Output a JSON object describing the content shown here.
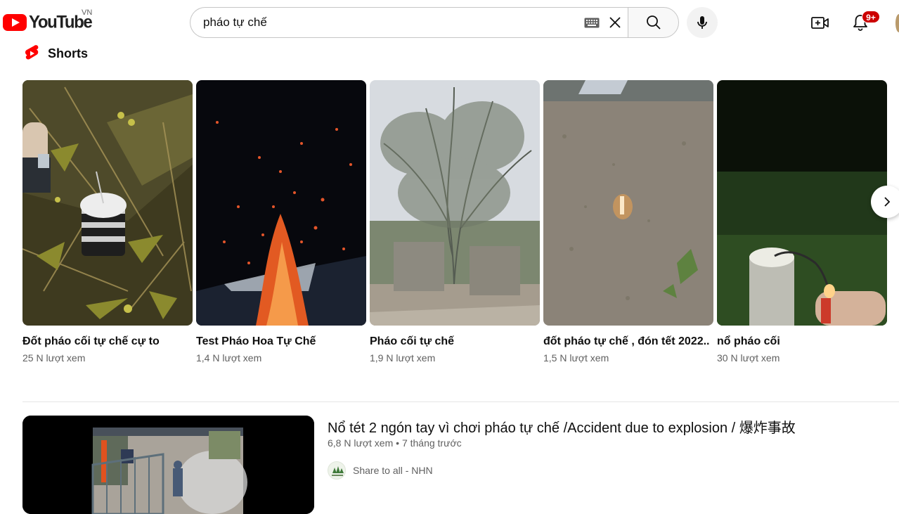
{
  "header": {
    "logo_text": "YouTube",
    "country_code": "VN",
    "search_value": "pháo tự chế",
    "notification_count": "9+"
  },
  "shorts": {
    "section_title": "Shorts",
    "items": [
      {
        "title": "Đốt pháo cối tự chế cự to",
        "views": "25 N lượt xem"
      },
      {
        "title": "Test Pháo Hoa Tự Chế",
        "views": "1,4 N lượt xem"
      },
      {
        "title": "Pháo cối tự chế",
        "views": "1,9 N lượt xem"
      },
      {
        "title": "đốt pháo tự chế , đón tết 2022..",
        "views": "1,5 N lượt xem"
      },
      {
        "title": "nổ pháo cối",
        "views": "30 N lượt xem"
      }
    ]
  },
  "video": {
    "title": "Nổ tét 2 ngón tay vì chơi pháo tự chế /Accident due to explosion / 爆炸事故",
    "views": "6,8 N lượt xem",
    "age": "7 tháng trước",
    "channel": "Share to all - NHN"
  },
  "colors": {
    "brand_red": "#ff0000",
    "badge_red": "#cc0000",
    "text_primary": "#0f0f0f",
    "text_secondary": "#606060"
  }
}
